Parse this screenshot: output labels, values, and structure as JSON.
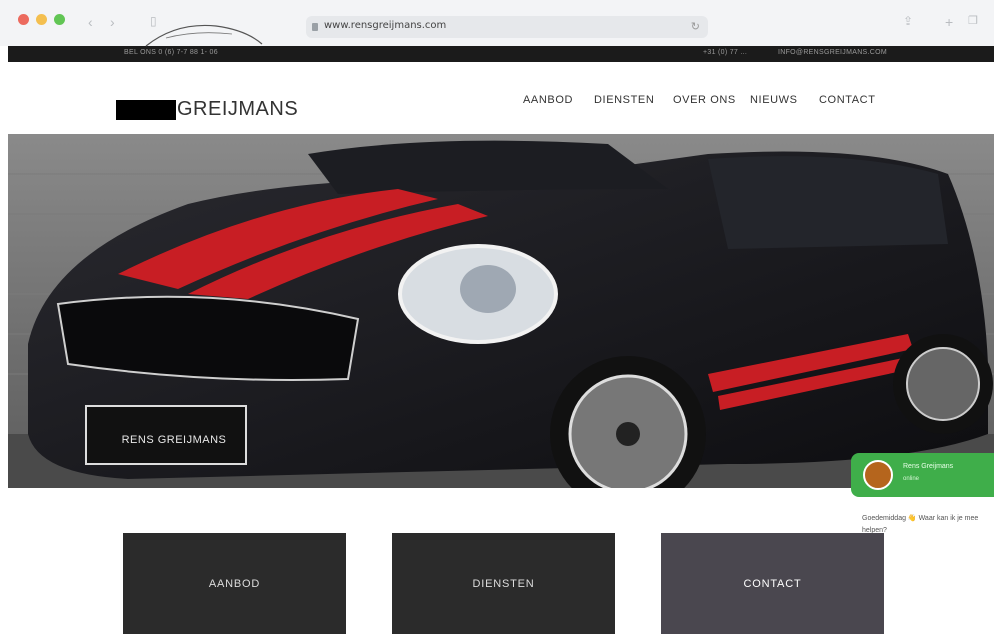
{
  "browser": {
    "url": "www.rensgreijmans.com",
    "dots": [
      "#ec6a5e",
      "#f4bf4f",
      "#61c554"
    ]
  },
  "topbar": {
    "left": "BEL ONS 0 (6) 7-7 88 1- 06",
    "right_phone": "+31 (0) 77 ...",
    "right_email": "INFO@RENSGREIJMANS.COM"
  },
  "site": {
    "logo": "GREIJMANS",
    "nav": [
      "AANBOD",
      "DIENSTEN",
      "OVER ONS",
      "NIEUWS",
      "CONTACT"
    ]
  },
  "hero": {
    "plate": "RENS GREIJMANS"
  },
  "cards": [
    {
      "label": "AANBOD",
      "color": "#2b2b2b"
    },
    {
      "label": "DIENSTEN",
      "color": "#2b2b2b"
    },
    {
      "label": "CONTACT",
      "color": "#4a474f"
    }
  ],
  "chat": {
    "name": "Rens Greijmans",
    "status": "online",
    "message": "Goedemiddag 👋 Waar kan ik je mee helpen?"
  }
}
